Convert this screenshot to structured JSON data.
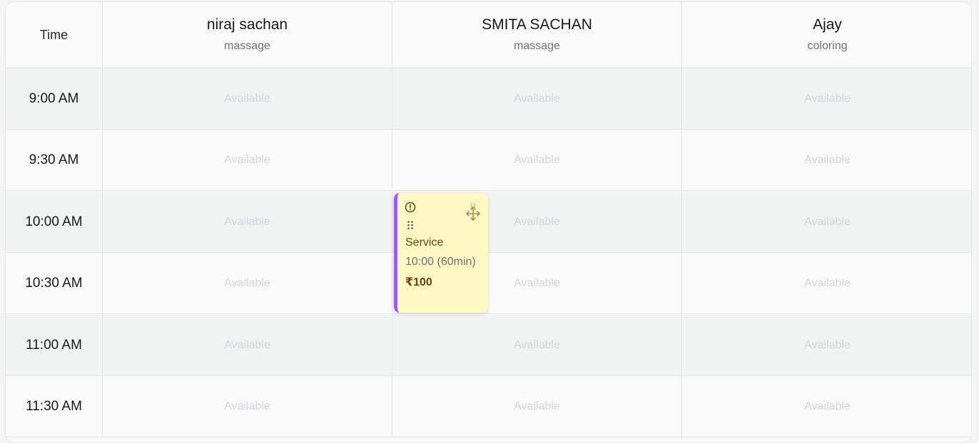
{
  "header": {
    "time_label": "Time",
    "staff": [
      {
        "name": "niraj sachan",
        "role": "massage"
      },
      {
        "name": "SMITA SACHAN",
        "role": "massage"
      },
      {
        "name": "Ajay",
        "role": "coloring"
      }
    ]
  },
  "slots": [
    {
      "time": "9:00 AM",
      "cells": [
        "Available",
        "Available",
        "Available"
      ]
    },
    {
      "time": "9:30 AM",
      "cells": [
        "Available",
        "Available",
        "Available"
      ]
    },
    {
      "time": "10:00 AM",
      "cells": [
        "Available",
        "Available",
        "Available"
      ]
    },
    {
      "time": "10:30 AM",
      "cells": [
        "Available",
        "Available",
        "Available"
      ]
    },
    {
      "time": "11:00 AM",
      "cells": [
        "Available",
        "Available",
        "Available"
      ]
    },
    {
      "time": "11:30 AM",
      "cells": [
        "Available",
        "Available",
        "Available"
      ]
    }
  ],
  "appointment": {
    "service": "Service",
    "time": "10:00 (60min)",
    "price": "₹100",
    "accent_color": "#a855f7",
    "background_color": "#fef9c3",
    "icons": [
      "alert-circle-icon",
      "drag-grip-icon",
      "move-icon"
    ]
  }
}
